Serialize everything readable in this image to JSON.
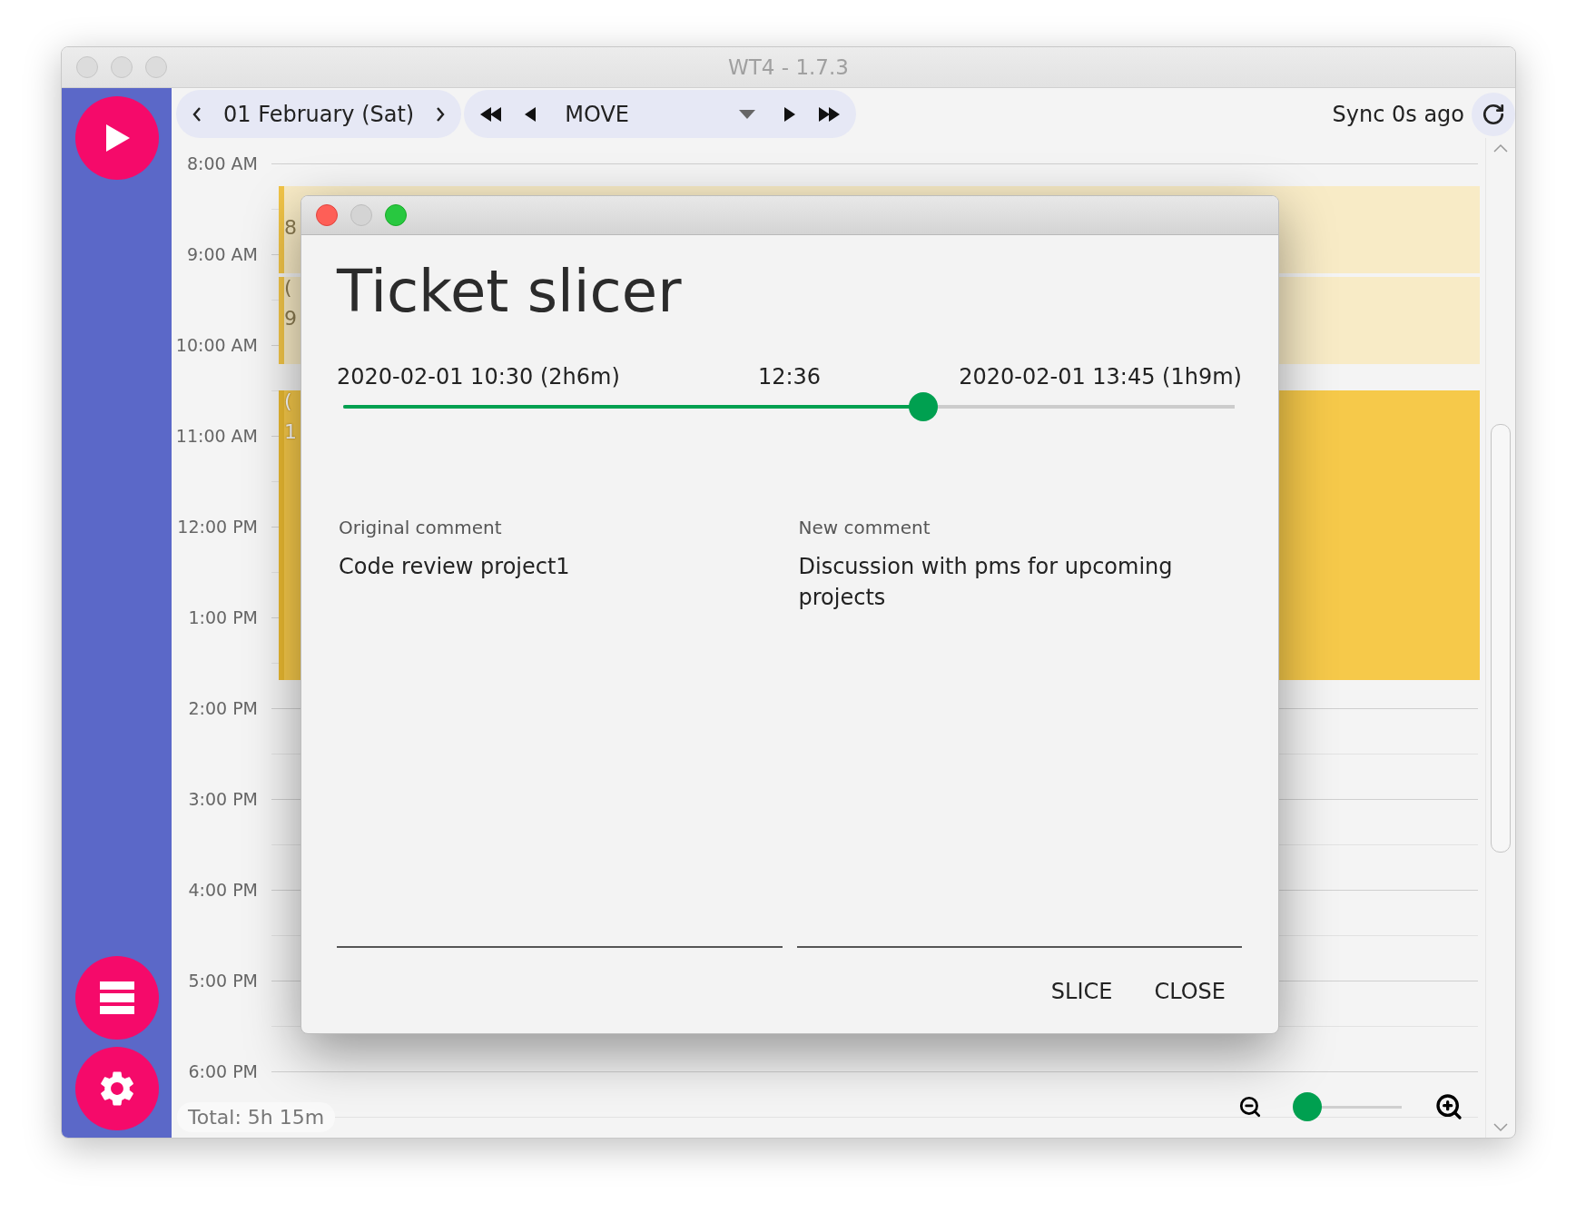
{
  "window": {
    "title": "WT4 - 1.7.3"
  },
  "toolbar": {
    "date": "01 February (Sat)",
    "mode": "MOVE",
    "sync": "Sync 0s ago"
  },
  "timeline": {
    "hours": [
      "8:00 AM",
      "9:00 AM",
      "10:00 AM",
      "11:00 AM",
      "12:00 PM",
      "1:00 PM",
      "2:00 PM",
      "3:00 PM",
      "4:00 PM",
      "5:00 PM",
      "6:00 PM"
    ],
    "events": [
      {
        "detail": "8",
        "selected": false
      },
      {
        "title": "(",
        "detail": "9",
        "selected": false
      },
      {
        "title": "(",
        "detail": "1",
        "selected": true
      }
    ],
    "total": "Total: 5h 15m"
  },
  "zoom": {
    "level": 0.12
  },
  "dialog": {
    "title": "Ticket slicer",
    "start": "2020-02-01 10:30 (2h6m)",
    "split": "12:36",
    "end": "2020-02-01 13:45 (1h9m)",
    "level": 0.651,
    "original": {
      "label": "Original comment",
      "value": "Code review project1"
    },
    "new": {
      "label": "New comment",
      "value": "Discussion with pms for upcoming projects"
    },
    "buttons": [
      "SLICE",
      "CLOSE"
    ]
  }
}
